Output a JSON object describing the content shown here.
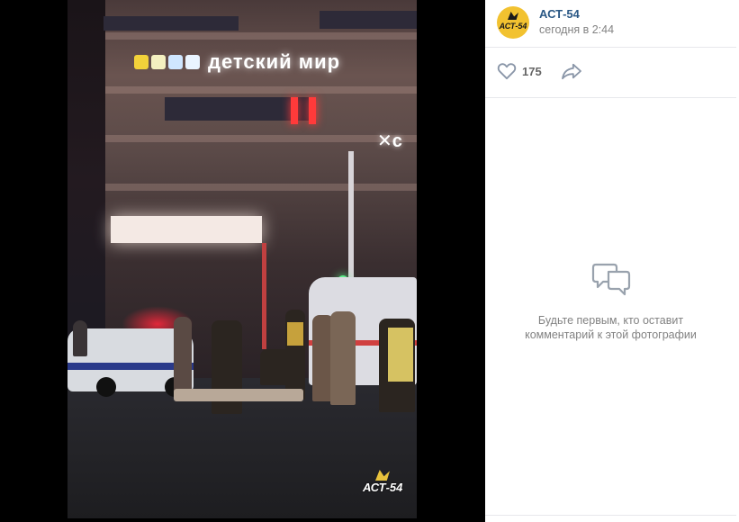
{
  "photo": {
    "sign_main": "детский мир",
    "sign_partial": "с",
    "watermark": "АСТ-54"
  },
  "post": {
    "author": "АСТ-54",
    "avatar_text": "АСТ-54",
    "date": "сегодня в 2:44",
    "likes": "175"
  },
  "comments": {
    "empty_message": "Будьте первым, кто оставит комментарий к этой фотографии"
  },
  "colors": {
    "link": "#2a5885",
    "muted": "#828282",
    "avatar_bg": "#f2c230"
  },
  "icons": {
    "like": "heart-icon",
    "share": "share-arrow-icon",
    "empty_comments": "speech-bubble-icon"
  }
}
